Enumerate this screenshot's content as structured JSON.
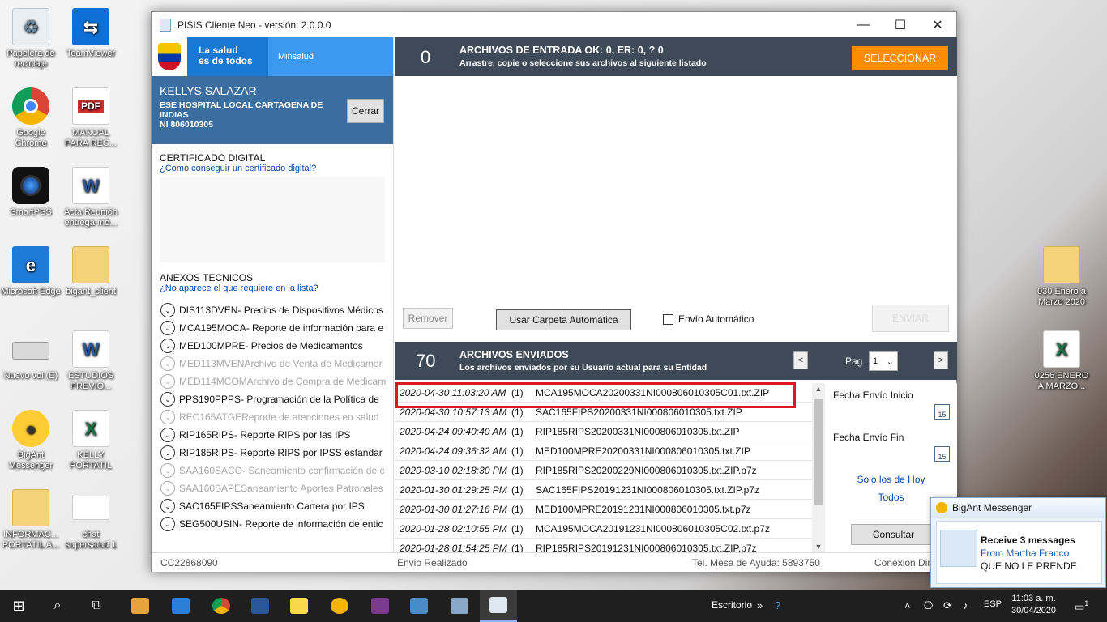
{
  "desktop_icons": [
    {
      "label": "Papelera de reciclaje",
      "icon": "recycle-bin-icon"
    },
    {
      "label": "TeamViewer",
      "icon": "teamviewer-icon"
    },
    {
      "label": "Google Chrome",
      "icon": "chrome-icon"
    },
    {
      "label": "MANUAL PARA REC...",
      "icon": "pdf-icon"
    },
    {
      "label": "SmartPSS",
      "icon": "camera-icon"
    },
    {
      "label": "Acta Reunión entrega mó...",
      "icon": "word-icon"
    },
    {
      "label": "Microsoft Edge",
      "icon": "edge-icon"
    },
    {
      "label": "bigant_client",
      "icon": "folder-icon"
    },
    {
      "label": "Nuevo vol (E)",
      "icon": "drive-icon"
    },
    {
      "label": "ESTUDIOS PREVIO...",
      "icon": "word-icon"
    },
    {
      "label": "BigAnt Messenger",
      "icon": "bigant-icon"
    },
    {
      "label": "KELLY PORTATIL",
      "icon": "excel-icon"
    },
    {
      "label": "INFORMAC... PORTATIL A...",
      "icon": "folder-icon"
    },
    {
      "label": "chat supersalud 1",
      "icon": "chat-icon"
    },
    {
      "label": "030 Enero a Marzo 2020",
      "icon": "folder-icon"
    },
    {
      "label": "0256 ENERO A MARZO...",
      "icon": "excel-icon"
    }
  ],
  "window": {
    "title": "PISIS Cliente Neo - versión: 2.0.0.0",
    "minimize": "—",
    "maximize": "☐",
    "close": "✕"
  },
  "brand": {
    "salud_line1": "La salud",
    "salud_line2": "es de todos",
    "minsalud": "Minsalud"
  },
  "user": {
    "name": "KELLYS SALAZAR",
    "org": "ESE HOSPITAL LOCAL CARTAGENA DE INDIAS",
    "ni": "NI 806010305",
    "cerrar": "Cerrar"
  },
  "certificado": {
    "title": "CERTIFICADO DIGITAL",
    "link": "¿Como conseguir un certificado digital?"
  },
  "anexos": {
    "title": "ANEXOS TECNICOS",
    "link": "¿No aparece el que requiere en la lista?",
    "items": [
      {
        "code": "DIS113DVEN",
        "desc": " - Precios de Dispositivos Médicos",
        "disabled": false
      },
      {
        "code": "MCA195MOCA",
        "desc": " - Reporte de información para e",
        "disabled": false
      },
      {
        "code": "MED100MPRE",
        "desc": " - Precios de Medicamentos",
        "disabled": false
      },
      {
        "code": "MED113MVEN",
        "desc": " Archivo de Venta de Medicamer",
        "disabled": true
      },
      {
        "code": "MED114MCOM",
        "desc": " Archivo de Compra de Medicam",
        "disabled": true
      },
      {
        "code": "PPS190PPPS",
        "desc": " - Programación de la Política de",
        "disabled": false
      },
      {
        "code": "REC165ATGE",
        "desc": " Reporte de atenciones en salud",
        "disabled": true
      },
      {
        "code": "RIP165RIPS",
        "desc": " - Reporte RIPS por las IPS",
        "disabled": false
      },
      {
        "code": "RIP185RIPS",
        "desc": " - Reporte RIPS por IPSS estandar",
        "disabled": false
      },
      {
        "code": "SAA160SACO",
        "desc": " - Saneamiento confirmación de c",
        "disabled": true
      },
      {
        "code": "SAA160SAPE",
        "desc": " Saneamiento Aportes Patronales",
        "disabled": true
      },
      {
        "code": "SAC165FIPS",
        "desc": "  Saneamiento Cartera por IPS",
        "disabled": false
      },
      {
        "code": "SEG500USIN",
        "desc": " - Reporte de información de entic",
        "disabled": false
      }
    ]
  },
  "entrada": {
    "count": "0",
    "title": "ARCHIVOS DE ENTRADA  OK: 0, ER: 0, ? 0",
    "subtitle": "Arrastre, copie o seleccione sus archivos al siguiente listado",
    "seleccionar": "SELECCIONAR"
  },
  "actions": {
    "remover": "Remover",
    "carpeta": "Usar Carpeta Automática",
    "envio_auto": "Envío Automático",
    "enviar": "ENVIAR"
  },
  "enviados": {
    "count": "70",
    "title": "ARCHIVOS ENVIADOS",
    "subtitle": "Los archivos enviados por su Usuario actual para su Entidad",
    "prev": "<",
    "next": ">",
    "pag_label": "Pag.",
    "pag_value": "1",
    "rows": [
      {
        "date": "2020-04-30 11:03:20 AM",
        "n": "(1)",
        "file": "MCA195MOCA20200331NI000806010305C01.txt.ZIP"
      },
      {
        "date": "2020-04-30 10:57:13 AM",
        "n": "(1)",
        "file": "SAC165FIPS20200331NI000806010305.txt.ZIP"
      },
      {
        "date": "2020-04-24 09:40:40 AM",
        "n": "(1)",
        "file": "RIP185RIPS20200331NI000806010305.txt.ZIP"
      },
      {
        "date": "2020-04-24 09:36:32 AM",
        "n": "(1)",
        "file": "MED100MPRE20200331NI000806010305.txt.ZIP"
      },
      {
        "date": "2020-03-10 02:18:30 PM",
        "n": "(1)",
        "file": "RIP185RIPS20200229NI000806010305.txt.ZIP.p7z"
      },
      {
        "date": "2020-01-30 01:29:25 PM",
        "n": "(1)",
        "file": "SAC165FIPS20191231NI000806010305.txt.ZIP.p7z"
      },
      {
        "date": "2020-01-30 01:27:16 PM",
        "n": "(1)",
        "file": "MED100MPRE20191231NI000806010305.txt.p7z"
      },
      {
        "date": "2020-01-28 02:10:55 PM",
        "n": "(1)",
        "file": "MCA195MOCA20191231NI000806010305C02.txt.p7z"
      },
      {
        "date": "2020-01-28 01:54:25 PM",
        "n": "(1)",
        "file": "RIP185RIPS20191231NI000806010305.txt.ZIP.p7z"
      }
    ]
  },
  "filters": {
    "inicio": "Fecha Envío Inicio",
    "fin": "Fecha Envío Fin",
    "cal": "15",
    "hoy": "Solo los de Hoy",
    "todos": "Todos",
    "consultar": "Consultar"
  },
  "status": {
    "cc": "CC22868090",
    "envio": "Envio Realizado",
    "tel": "Tel. Mesa de Ayuda: 5893750",
    "conexion": "Conexión Dir"
  },
  "notification": {
    "app": "BigAnt Messenger",
    "line1": "Receive 3 messages",
    "line2": "From Martha Franco",
    "line3": "QUE NO LE PRENDE"
  },
  "taskbar": {
    "escritorio": "Escritorio",
    "lang": "ESP",
    "time": "11:03 a. m.",
    "date": "30/04/2020",
    "notif_count": "1"
  },
  "colors": {
    "header_bg": "#3f4a58",
    "accent_orange": "#ff8c00",
    "user_panel": "#3b6ea0",
    "highlight": "#e0161f"
  }
}
